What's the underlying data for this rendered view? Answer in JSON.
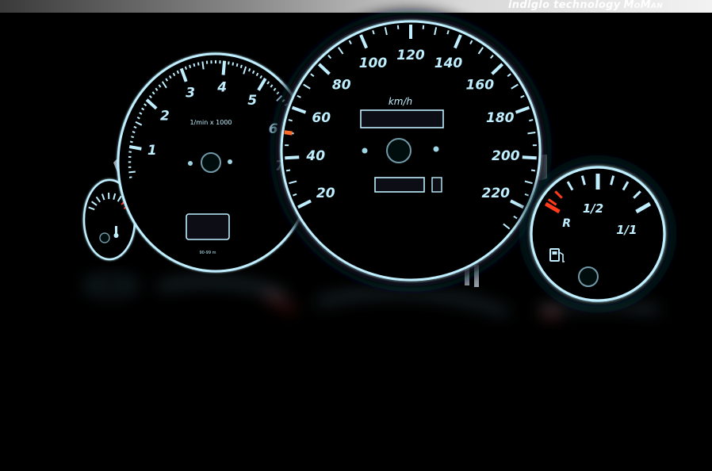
{
  "banner": {
    "tagline": "indiglo technology",
    "brand": "MoMan"
  },
  "tachometer": {
    "labels": [
      "1",
      "2",
      "3",
      "4",
      "5",
      "6",
      "7"
    ],
    "unit_label": "1/min x 1000",
    "fine_print": "90-99 m"
  },
  "speedometer": {
    "labels": [
      "20",
      "40",
      "60",
      "80",
      "100",
      "120",
      "140",
      "160",
      "180",
      "200",
      "220"
    ],
    "unit_label": "km/h"
  },
  "fuel_gauge": {
    "reserve_label": "R",
    "half_label": "1/2",
    "full_label": "1/1",
    "icon": "fuel-pump-icon"
  },
  "temp_gauge": {
    "icon": "thermometer-icon"
  },
  "colors": {
    "glow": "#bfefff",
    "redline": "#ff2a1a",
    "reserve": "#ff3a1a",
    "background": "#000000"
  }
}
